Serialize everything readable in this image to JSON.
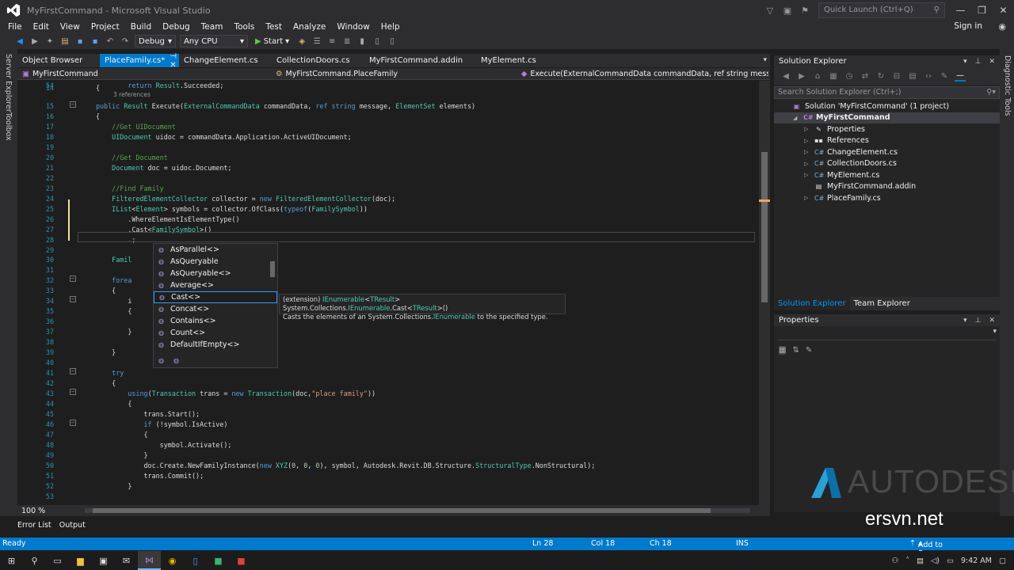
{
  "window": {
    "title": "MyFirstCommand - Microsoft Visual Studio",
    "quick_launch_placeholder": "Quick Launch (Ctrl+Q)",
    "sign_in": "Sign in"
  },
  "menu": [
    "File",
    "Edit",
    "View",
    "Project",
    "Build",
    "Debug",
    "Team",
    "Tools",
    "Test",
    "Analyze",
    "Window",
    "Help"
  ],
  "toolbar": {
    "configuration": "Debug",
    "platform": "Any CPU",
    "start_label": "Start"
  },
  "left_strip": [
    "Server Explorer",
    "Toolbox"
  ],
  "right_strip": [
    "Diagnostic Tools"
  ],
  "tabs": [
    {
      "label": "Object Browser",
      "active": false
    },
    {
      "label": "PlaceFamily.cs*",
      "active": true
    },
    {
      "label": "ChangeElement.cs",
      "active": false
    },
    {
      "label": "CollectionDoors.cs",
      "active": false
    },
    {
      "label": "MyFirstCommand.addin",
      "active": false
    },
    {
      "label": "MyElement.cs",
      "active": false
    }
  ],
  "navbar": {
    "project": "MyFirstCommand",
    "class": "MyFirstCommand.PlaceFamily",
    "member": "Execute(ExternalCommandData commandData, ref string message,"
  },
  "editor": {
    "refs_label": "3 references",
    "zoom": "100 %",
    "lines": [
      {
        "n": "14",
        "html": "{"
      },
      {
        "n": "15",
        "html": "<span class=\"kw\">public</span> <span class=\"ty\">Result</span> Execute(<span class=\"ty\">ExternalCommandData</span> commandData, <span class=\"kw\">ref string</span> message, <span class=\"ty\">ElementSet</span> elements)"
      },
      {
        "n": "16",
        "html": "{"
      },
      {
        "n": "17",
        "html": "    <span class=\"cm\">//Get UIDocument</span>"
      },
      {
        "n": "18",
        "html": "    <span class=\"ty\">UIDocument</span> uidoc = commandData.Application.ActiveUIDocument;"
      },
      {
        "n": "19",
        "html": ""
      },
      {
        "n": "20",
        "html": "    <span class=\"cm\">//Get Document</span>"
      },
      {
        "n": "21",
        "html": "    <span class=\"ty\">Document</span> doc = uidoc.Document;"
      },
      {
        "n": "22",
        "html": ""
      },
      {
        "n": "23",
        "html": "    <span class=\"cm\">//Find Family</span>"
      },
      {
        "n": "24",
        "html": "    <span class=\"ty\">FilteredElementCollector</span> collector = <span class=\"kw\">new</span> <span class=\"ty\">FilteredElementCollector</span>(doc);"
      },
      {
        "n": "25",
        "html": "    <span class=\"ty\">IList</span>&lt;<span class=\"ty\">Element</span>&gt; symbols = collector.OfClass(<span class=\"kw\">typeof</span>(<span class=\"ty\">FamilySymbol</span>))"
      },
      {
        "n": "26",
        "html": "        .WhereElementIsElementType()"
      },
      {
        "n": "27",
        "html": "        .Cast&lt;<span class=\"ty\">FamilySymbol</span>&gt;()"
      },
      {
        "n": "28",
        "html": "        .;"
      },
      {
        "n": "29",
        "html": ""
      },
      {
        "n": "30",
        "html": "    <span class=\"ty\">Famil</span>"
      },
      {
        "n": "31",
        "html": ""
      },
      {
        "n": "32",
        "html": "    <span class=\"kw\">forea</span>                             ls)"
      },
      {
        "n": "33",
        "html": "    {"
      },
      {
        "n": "34",
        "html": "        i"
      },
      {
        "n": "35",
        "html": "        {                           ol;"
      },
      {
        "n": "36",
        "html": ""
      },
      {
        "n": "37",
        "html": "        }"
      },
      {
        "n": "38",
        "html": ""
      },
      {
        "n": "39",
        "html": "    }"
      },
      {
        "n": "40",
        "html": ""
      },
      {
        "n": "41",
        "html": "    <span class=\"kw\">try</span>"
      },
      {
        "n": "42",
        "html": "    {"
      },
      {
        "n": "43",
        "html": "        <span class=\"kw\">using</span>(<span class=\"ty\">Transaction</span> trans = <span class=\"kw\">new</span> <span class=\"ty\">Transaction</span>(doc,<span class=\"st\">\"place family\"</span>))"
      },
      {
        "n": "44",
        "html": "        {"
      },
      {
        "n": "45",
        "html": "            trans.Start();"
      },
      {
        "n": "46",
        "html": "            <span class=\"kw\">if</span> (!symbol.IsActive)"
      },
      {
        "n": "47",
        "html": "            {"
      },
      {
        "n": "48",
        "html": "                symbol.Activate();"
      },
      {
        "n": "49",
        "html": "            }"
      },
      {
        "n": "50",
        "html": "            doc.Create.NewFamilyInstance(<span class=\"kw\">new</span> <span class=\"ty\">XYZ</span>(<span class=\"nm\">0</span>, <span class=\"nm\">0</span>, <span class=\"nm\">0</span>), symbol, Autodesk.Revit.DB.Structure.<span class=\"ty\">StructuralType</span>.NonStructural);"
      },
      {
        "n": "51",
        "html": "            trans.Commit();"
      },
      {
        "n": "52",
        "html": "        }"
      },
      {
        "n": "53",
        "html": ""
      },
      {
        "n": "54",
        "html": "        <span class=\"kw\">return</span> <span class=\"ty\">Result</span>.Succeeded;"
      }
    ]
  },
  "completion": {
    "items": [
      "AsParallel<>",
      "AsQueryable",
      "AsQueryable<>",
      "Average<>",
      "Cast<>",
      "Concat<>",
      "Contains<>",
      "Count<>",
      "DefaultIfEmpty<>"
    ],
    "selected_index": 4,
    "tooltip_line1_html": "(extension) <span class=\"ty\">IEnumerable</span>&lt;<span class=\"ty\">TResult</span>&gt; System.Collections.<span class=\"ty\">IEnumerable</span>.Cast&lt;<span class=\"ty\">TResult</span>&gt;()",
    "tooltip_line2_html": "Casts the elements of an System.Collections.<span class=\"ty\">IEnumerable</span> to the specified type."
  },
  "solution_explorer": {
    "title": "Solution Explorer",
    "search_placeholder": "Search Solution Explorer (Ctrl+;)",
    "tree": [
      {
        "label": "Solution 'MyFirstCommand' (1 project)",
        "indent": 0,
        "icon": "solution-icon",
        "arrow": "",
        "selected": false
      },
      {
        "label": "MyFirstCommand",
        "indent": 1,
        "icon": "csharp-project-icon",
        "arrow": "open",
        "selected": true
      },
      {
        "label": "Properties",
        "indent": 2,
        "icon": "wrench-icon",
        "arrow": "closed",
        "selected": false
      },
      {
        "label": "References",
        "indent": 2,
        "icon": "references-icon",
        "arrow": "closed",
        "selected": false
      },
      {
        "label": "ChangeElement.cs",
        "indent": 2,
        "icon": "csharp-file-icon",
        "arrow": "closed",
        "selected": false
      },
      {
        "label": "CollectionDoors.cs",
        "indent": 2,
        "icon": "csharp-file-icon",
        "arrow": "closed",
        "selected": false
      },
      {
        "label": "MyElement.cs",
        "indent": 2,
        "icon": "csharp-file-icon",
        "arrow": "closed",
        "selected": false
      },
      {
        "label": "MyFirstCommand.addin",
        "indent": 2,
        "icon": "addin-file-icon",
        "arrow": "",
        "selected": false
      },
      {
        "label": "PlaceFamily.cs",
        "indent": 2,
        "icon": "csharp-file-icon",
        "arrow": "closed",
        "selected": false
      }
    ],
    "bottom_tabs": [
      "Solution Explorer",
      "Team Explorer"
    ]
  },
  "properties_panel": {
    "title": "Properties"
  },
  "bottom_tabs": [
    "Error List",
    "Output"
  ],
  "statusbar": {
    "ready": "Ready",
    "ln": "Ln 28",
    "col": "Col 18",
    "ch": "Ch 18",
    "ins": "INS",
    "source_control": "Add to Source Control"
  },
  "branding": {
    "autodesk": "AUTODESK",
    "watermark": "ersvn.net"
  },
  "taskbar": {
    "clock": "9:42 AM",
    "icons": [
      "windows-start-icon",
      "search-icon",
      "task-view-icon",
      "file-explorer-icon",
      "store-icon",
      "mail-icon",
      "visual-studio-icon",
      "chrome-icon",
      "document-icon",
      "green-app-icon",
      "red-app-icon"
    ]
  },
  "colors": {
    "accent": "#007acc",
    "background": "#1e1e1e",
    "chrome": "#2d2d30"
  }
}
